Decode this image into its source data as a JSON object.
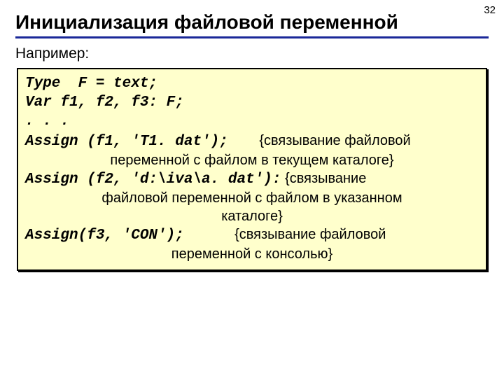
{
  "pagenum": "32",
  "title": "Инициализация файловой переменной",
  "lead": "Например:",
  "code": {
    "l1": "Type  F = text;",
    "l2": "Var f1, f2, f3: F;",
    "l3": ". . .",
    "l4a": "Assign (f1, 'T1. dat');",
    "c1a": "{связывание файловой",
    "c1b": "переменной с файлом в текущем каталоге}",
    "l5a": "Assign (f2, 'd:\\iva\\a. dat'):",
    "c2a": "{связывание",
    "c2b": "файловой переменной с файлом в указанном",
    "c2c": "каталоге}",
    "l6a": "Assign(f3, 'CON');",
    "c3a": "{связывание файловой",
    "c3b": "переменной с консолью}"
  }
}
